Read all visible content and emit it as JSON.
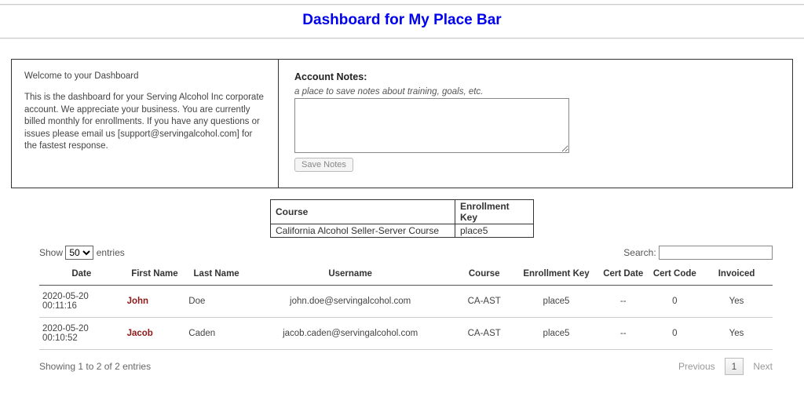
{
  "header": {
    "title": "Dashboard for My Place Bar"
  },
  "welcome": {
    "heading": "Welcome to your Dashboard",
    "body": "This is the dashboard for your Serving Alcohol Inc corporate account. We appreciate your business. You are currently billed monthly for enrollments. If you have any questions or issues please email us [support@servingalcohol.com] for the fastest response."
  },
  "notes": {
    "label": "Account Notes:",
    "hint": "a place to save notes about training, goals, etc.",
    "value": "",
    "save_label": "Save Notes"
  },
  "course_keys": {
    "headers": {
      "course": "Course",
      "key": "Enrollment Key"
    },
    "rows": [
      {
        "course": "California Alcohol Seller-Server Course",
        "key": "place5"
      }
    ]
  },
  "datatable": {
    "length_prefix": "Show",
    "length_value": "50",
    "length_suffix": "entries",
    "search_label": "Search:",
    "search_value": "",
    "columns": {
      "date": "Date",
      "first": "First Name",
      "last": "Last Name",
      "user": "Username",
      "course": "Course",
      "key": "Enrollment Key",
      "cert_date": "Cert Date",
      "cert_code": "Cert Code",
      "invoiced": "Invoiced"
    },
    "rows": [
      {
        "date": "2020-05-20 00:11:16",
        "first": "John",
        "last": "Doe",
        "user": "john.doe@servingalcohol.com",
        "course": "CA-AST",
        "key": "place5",
        "cert_date": "--",
        "cert_code": "0",
        "invoiced": "Yes"
      },
      {
        "date": "2020-05-20 00:10:52",
        "first": "Jacob",
        "last": "Caden",
        "user": "jacob.caden@servingalcohol.com",
        "course": "CA-AST",
        "key": "place5",
        "cert_date": "--",
        "cert_code": "0",
        "invoiced": "Yes"
      }
    ],
    "info": "Showing 1 to 2 of 2 entries",
    "pager": {
      "prev": "Previous",
      "page": "1",
      "next": "Next"
    }
  }
}
